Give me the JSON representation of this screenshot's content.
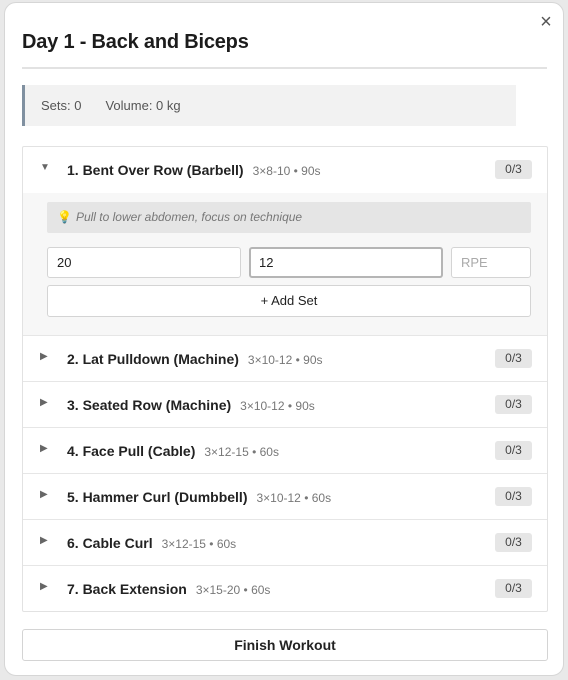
{
  "modal": {
    "title": "Day 1 - Back and Biceps",
    "close_glyph": "×"
  },
  "stats": {
    "sets": "Sets: 0",
    "volume": "Volume: 0 kg"
  },
  "exercises": [
    {
      "name": "1. Bent Over Row (Barbell)",
      "meta": "3×8-10 • 90s",
      "badge": "0/3",
      "expanded": true,
      "chevron": "▼",
      "tip": "Pull to lower abdomen, focus on technique",
      "tip_icon": "lightbulb-icon",
      "weight_value": "20",
      "reps_value": "12",
      "rpe_placeholder": "RPE",
      "add_set_label": "+ Add Set"
    },
    {
      "name": "2. Lat Pulldown (Machine)",
      "meta": "3×10-12 • 90s",
      "badge": "0/3",
      "chevron": "▶"
    },
    {
      "name": "3. Seated Row (Machine)",
      "meta": "3×10-12 • 90s",
      "badge": "0/3",
      "chevron": "▶"
    },
    {
      "name": "4. Face Pull (Cable)",
      "meta": "3×12-15 • 60s",
      "badge": "0/3",
      "chevron": "▶"
    },
    {
      "name": "5. Hammer Curl (Dumbbell)",
      "meta": "3×10-12 • 60s",
      "badge": "0/3",
      "chevron": "▶"
    },
    {
      "name": "6. Cable Curl",
      "meta": "3×12-15 • 60s",
      "badge": "0/3",
      "chevron": "▶"
    },
    {
      "name": "7. Back Extension",
      "meta": "3×15-20 • 60s",
      "badge": "0/3",
      "chevron": "▶"
    }
  ],
  "footer": {
    "finish_label": "Finish Workout"
  }
}
